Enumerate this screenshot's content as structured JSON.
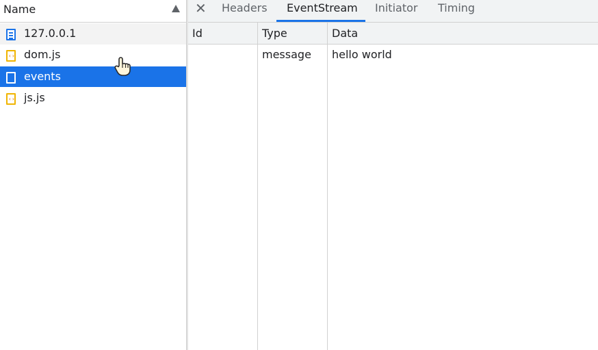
{
  "request_list": {
    "column_header": "Name",
    "sort_indicator_icon": "sort-ascending-icon",
    "items": [
      {
        "label": "127.0.0.1",
        "icon": "document-icon"
      },
      {
        "label": "dom.js",
        "icon": "script-icon",
        "icon_text": "‹›"
      },
      {
        "label": "events",
        "icon": "eventsource-icon",
        "selected": true
      },
      {
        "label": "js.js",
        "icon": "script-icon",
        "icon_text": "‹›"
      }
    ]
  },
  "detail_tabs": {
    "close_icon": "close-icon",
    "close_glyph": "✕",
    "tabs": [
      {
        "label": "Headers"
      },
      {
        "label": "EventStream",
        "active": true
      },
      {
        "label": "Initiator"
      },
      {
        "label": "Timing"
      }
    ]
  },
  "event_stream": {
    "columns": [
      "Id",
      "Type",
      "Data"
    ],
    "rows": [
      {
        "id": "",
        "type": "message",
        "data": "hello world"
      }
    ]
  },
  "colors": {
    "accent": "#1a73e8",
    "selected_row_text": "#ffffff",
    "script_icon": "#f0b400"
  }
}
